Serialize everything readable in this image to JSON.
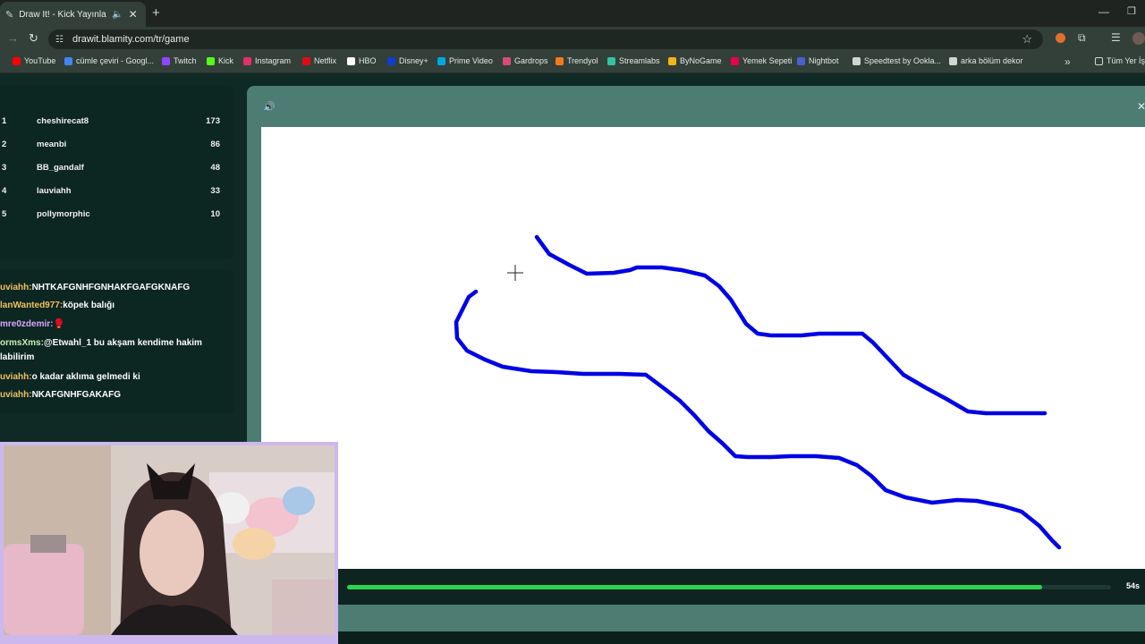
{
  "browser": {
    "tab_title": "Draw It! - Kick Yayınları İçin",
    "url": "drawit.blamity.com/tr/game",
    "bookmarks": [
      {
        "label": "YouTube",
        "color": "#ff0000"
      },
      {
        "label": "cümle çeviri - Googl...",
        "color": "#4285f4"
      },
      {
        "label": "Twitch",
        "color": "#9146ff"
      },
      {
        "label": "Kick",
        "color": "#53fc18"
      },
      {
        "label": "Instagram",
        "color": "#e1306c"
      },
      {
        "label": "Netflix",
        "color": "#e50914"
      },
      {
        "label": "HBO",
        "color": "#ffffff"
      },
      {
        "label": "Disney+",
        "color": "#113ccf"
      },
      {
        "label": "Prime Video",
        "color": "#00a8e1"
      },
      {
        "label": "Gardrops",
        "color": "#d84a7a"
      },
      {
        "label": "Trendyol",
        "color": "#f27a1a"
      },
      {
        "label": "Streamlabs",
        "color": "#31c3a2"
      },
      {
        "label": "ByNoGame",
        "color": "#f5b41a"
      },
      {
        "label": "Yemek Sepeti",
        "color": "#ea004b"
      },
      {
        "label": "Nightbot",
        "color": "#4a5fd0"
      },
      {
        "label": "Speedtest by Ookla...",
        "color": "#cfd7d2"
      },
      {
        "label": "arka bölüm dekor",
        "color": "#cfd7d2"
      }
    ],
    "all_bookmarks_label": "Tüm Yer İşa"
  },
  "leaderboard": [
    {
      "rank": "1",
      "name": "cheshirecat8",
      "score": "173"
    },
    {
      "rank": "2",
      "name": "meanbi",
      "score": "86"
    },
    {
      "rank": "3",
      "name": "BB_gandalf",
      "score": "48"
    },
    {
      "rank": "4",
      "name": "lauviahh",
      "score": "33"
    },
    {
      "rank": "5",
      "name": "pollymorphic",
      "score": "10"
    }
  ],
  "chat": [
    {
      "user": "uviahh:",
      "message": "NHTKAFGNHFGNHAKFGAFGKNAFG",
      "color": "#f0c060"
    },
    {
      "user": "lanWanted977:",
      "message": "köpek balığı",
      "color": "#f0c060"
    },
    {
      "user": "mre0zdemir:",
      "message": "🥊",
      "color": "#d7a8ff"
    },
    {
      "user": "ormsXms:",
      "message": "@Etwahl_1 bu akşam kendime hakim",
      "color": "#c8f0b0"
    },
    {
      "user": "",
      "message": "labilirim",
      "color": "#ffffff"
    },
    {
      "user": "uviahh:",
      "message": "o kadar aklıma gelmedi ki",
      "color": "#f0c060"
    },
    {
      "user": "uviahh:",
      "message": "NKAFGNHFGAKAFG",
      "color": "#f0c060"
    }
  ],
  "game": {
    "timer_label": "54s",
    "timer_progress": 0.91,
    "stroke_color": "#0000e6"
  }
}
